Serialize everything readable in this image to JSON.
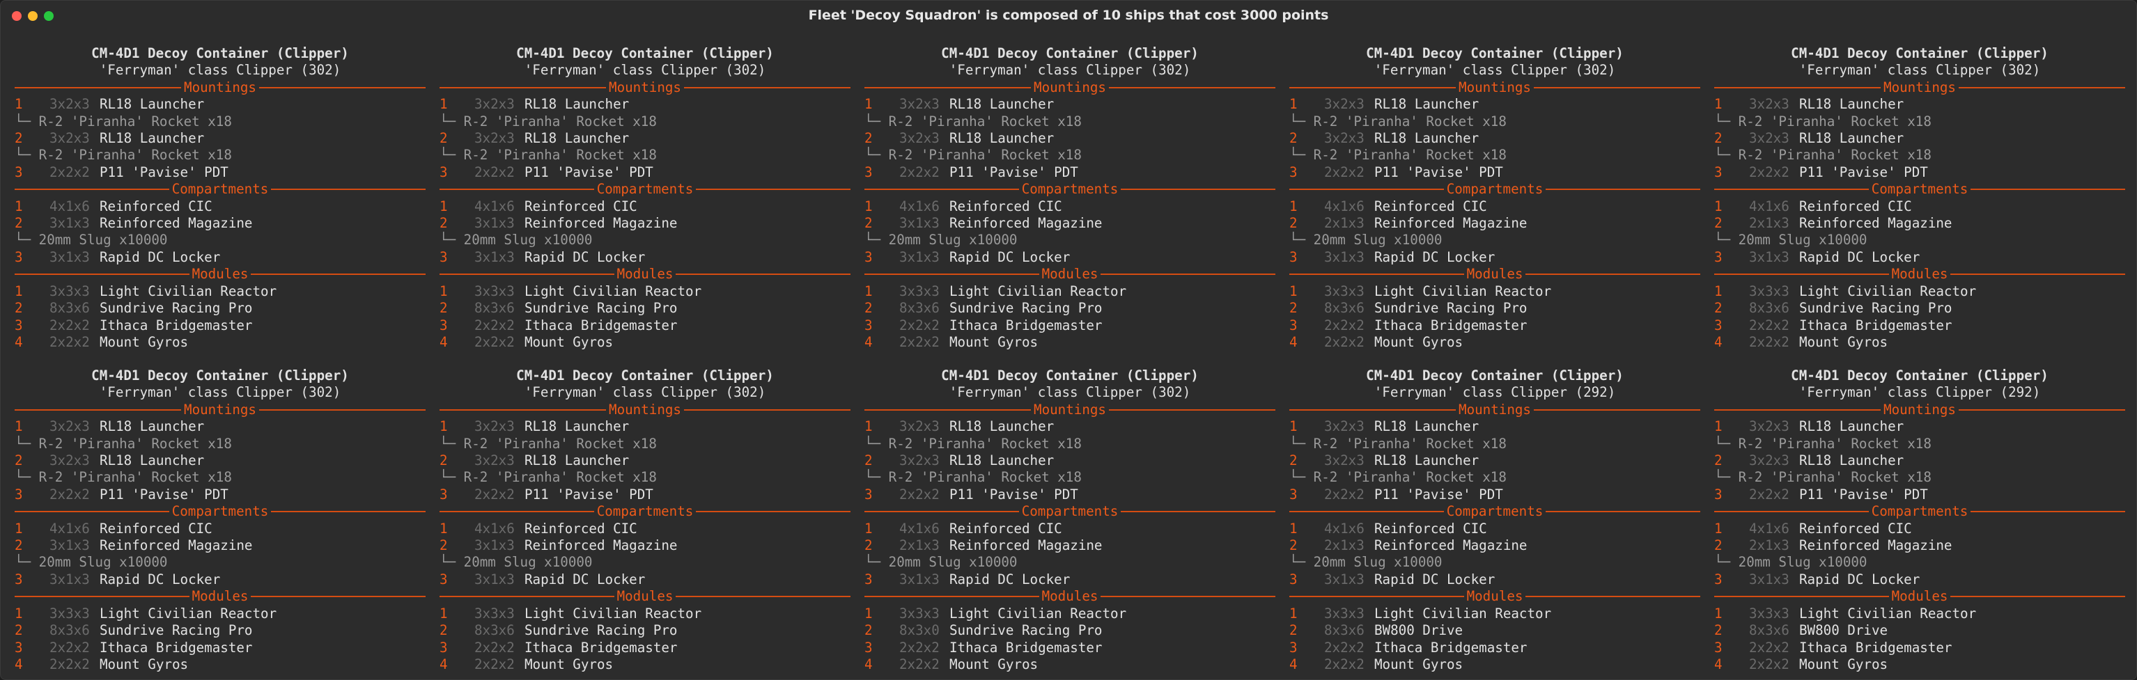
{
  "window": {
    "title": "Fleet 'Decoy Squadron' is composed of 10 ships that cost 3000 points",
    "buttons": {
      "close_color": "#ff5f57",
      "minimize_color": "#febc2e",
      "zoom_color": "#28c840"
    }
  },
  "colors": {
    "accent": "#ee5a1a",
    "text": "#e2e2e2",
    "muted": "#6b6b6b",
    "background": "#2c2c2c"
  },
  "ships": [
    {
      "name": "CM-4D1 Decoy Container (Clipper)",
      "class": "'Ferryman' class Clipper (302)",
      "mountings_label": "Mountings",
      "mountings": [
        {
          "num": "1",
          "size": "3x2x3",
          "name": "RL18 Launcher"
        },
        {
          "sub": "└─ R-2 'Piranha' Rocket x18"
        },
        {
          "num": "2",
          "size": "3x2x3",
          "name": "RL18 Launcher"
        },
        {
          "sub": "└─ R-2 'Piranha' Rocket x18"
        },
        {
          "num": "3",
          "size": "2x2x2",
          "name": "P11 'Pavise' PDT"
        }
      ],
      "compartments_label": "Compartments",
      "compartments": [
        {
          "num": "1",
          "size": "4x1x6",
          "name": "Reinforced CIC"
        },
        {
          "num": "2",
          "size": "3x1x3",
          "name": "Reinforced Magazine"
        },
        {
          "sub": "└─ 20mm Slug x10000"
        },
        {
          "num": "3",
          "size": "3x1x3",
          "name": "Rapid DC Locker"
        }
      ],
      "modules_label": "Modules",
      "modules": [
        {
          "num": "1",
          "size": "3x3x3",
          "name": "Light Civilian Reactor"
        },
        {
          "num": "2",
          "size": "8x3x6",
          "name": "Sundrive Racing Pro"
        },
        {
          "num": "3",
          "size": "2x2x2",
          "name": "Ithaca Bridgemaster"
        },
        {
          "num": "4",
          "size": "2x2x2",
          "name": "Mount Gyros"
        }
      ]
    },
    {
      "name": "CM-4D1 Decoy Container (Clipper)",
      "class": "'Ferryman' class Clipper (302)",
      "mountings_label": "Mountings",
      "mountings": [
        {
          "num": "1",
          "size": "3x2x3",
          "name": "RL18 Launcher"
        },
        {
          "sub": "└─ R-2 'Piranha' Rocket x18"
        },
        {
          "num": "2",
          "size": "3x2x3",
          "name": "RL18 Launcher"
        },
        {
          "sub": "└─ R-2 'Piranha' Rocket x18"
        },
        {
          "num": "3",
          "size": "2x2x2",
          "name": "P11 'Pavise' PDT"
        }
      ],
      "compartments_label": "Compartments",
      "compartments": [
        {
          "num": "1",
          "size": "4x1x6",
          "name": "Reinforced CIC"
        },
        {
          "num": "2",
          "size": "3x1x3",
          "name": "Reinforced Magazine"
        },
        {
          "sub": "└─ 20mm Slug x10000"
        },
        {
          "num": "3",
          "size": "3x1x3",
          "name": "Rapid DC Locker"
        }
      ],
      "modules_label": "Modules",
      "modules": [
        {
          "num": "1",
          "size": "3x3x3",
          "name": "Light Civilian Reactor"
        },
        {
          "num": "2",
          "size": "8x3x6",
          "name": "Sundrive Racing Pro"
        },
        {
          "num": "3",
          "size": "2x2x2",
          "name": "Ithaca Bridgemaster"
        },
        {
          "num": "4",
          "size": "2x2x2",
          "name": "Mount Gyros"
        }
      ]
    },
    {
      "name": "CM-4D1 Decoy Container (Clipper)",
      "class": "'Ferryman' class Clipper (302)",
      "mountings_label": "Mountings",
      "mountings": [
        {
          "num": "1",
          "size": "3x2x3",
          "name": "RL18 Launcher"
        },
        {
          "sub": "└─ R-2 'Piranha' Rocket x18"
        },
        {
          "num": "2",
          "size": "3x2x3",
          "name": "RL18 Launcher"
        },
        {
          "sub": "└─ R-2 'Piranha' Rocket x18"
        },
        {
          "num": "3",
          "size": "2x2x2",
          "name": "P11 'Pavise' PDT"
        }
      ],
      "compartments_label": "Compartments",
      "compartments": [
        {
          "num": "1",
          "size": "4x1x6",
          "name": "Reinforced CIC"
        },
        {
          "num": "2",
          "size": "3x1x3",
          "name": "Reinforced Magazine"
        },
        {
          "sub": "└─ 20mm Slug x10000"
        },
        {
          "num": "3",
          "size": "3x1x3",
          "name": "Rapid DC Locker"
        }
      ],
      "modules_label": "Modules",
      "modules": [
        {
          "num": "1",
          "size": "3x3x3",
          "name": "Light Civilian Reactor"
        },
        {
          "num": "2",
          "size": "8x3x6",
          "name": "Sundrive Racing Pro"
        },
        {
          "num": "3",
          "size": "2x2x2",
          "name": "Ithaca Bridgemaster"
        },
        {
          "num": "4",
          "size": "2x2x2",
          "name": "Mount Gyros"
        }
      ]
    },
    {
      "name": "CM-4D1 Decoy Container (Clipper)",
      "class": "'Ferryman' class Clipper (302)",
      "mountings_label": "Mountings",
      "mountings": [
        {
          "num": "1",
          "size": "3x2x3",
          "name": "RL18 Launcher"
        },
        {
          "sub": "└─ R-2 'Piranha' Rocket x18"
        },
        {
          "num": "2",
          "size": "3x2x3",
          "name": "RL18 Launcher"
        },
        {
          "sub": "└─ R-2 'Piranha' Rocket x18"
        },
        {
          "num": "3",
          "size": "2x2x2",
          "name": "P11 'Pavise' PDT"
        }
      ],
      "compartments_label": "Compartments",
      "compartments": [
        {
          "num": "1",
          "size": "4x1x6",
          "name": "Reinforced CIC"
        },
        {
          "num": "2",
          "size": "2x1x3",
          "name": "Reinforced Magazine"
        },
        {
          "sub": "└─ 20mm Slug x10000"
        },
        {
          "num": "3",
          "size": "3x1x3",
          "name": "Rapid DC Locker"
        }
      ],
      "modules_label": "Modules",
      "modules": [
        {
          "num": "1",
          "size": "3x3x3",
          "name": "Light Civilian Reactor"
        },
        {
          "num": "2",
          "size": "8x3x6",
          "name": "Sundrive Racing Pro"
        },
        {
          "num": "3",
          "size": "2x2x2",
          "name": "Ithaca Bridgemaster"
        },
        {
          "num": "4",
          "size": "2x2x2",
          "name": "Mount Gyros"
        }
      ]
    },
    {
      "name": "CM-4D1 Decoy Container (Clipper)",
      "class": "'Ferryman' class Clipper (302)",
      "mountings_label": "Mountings",
      "mountings": [
        {
          "num": "1",
          "size": "3x2x3",
          "name": "RL18 Launcher"
        },
        {
          "sub": "└─ R-2 'Piranha' Rocket x18"
        },
        {
          "num": "2",
          "size": "3x2x3",
          "name": "RL18 Launcher"
        },
        {
          "sub": "└─ R-2 'Piranha' Rocket x18"
        },
        {
          "num": "3",
          "size": "2x2x2",
          "name": "P11 'Pavise' PDT"
        }
      ],
      "compartments_label": "Compartments",
      "compartments": [
        {
          "num": "1",
          "size": "4x1x6",
          "name": "Reinforced CIC"
        },
        {
          "num": "2",
          "size": "2x1x3",
          "name": "Reinforced Magazine"
        },
        {
          "sub": "└─ 20mm Slug x10000"
        },
        {
          "num": "3",
          "size": "3x1x3",
          "name": "Rapid DC Locker"
        }
      ],
      "modules_label": "Modules",
      "modules": [
        {
          "num": "1",
          "size": "3x3x3",
          "name": "Light Civilian Reactor"
        },
        {
          "num": "2",
          "size": "8x3x6",
          "name": "Sundrive Racing Pro"
        },
        {
          "num": "3",
          "size": "2x2x2",
          "name": "Ithaca Bridgemaster"
        },
        {
          "num": "4",
          "size": "2x2x2",
          "name": "Mount Gyros"
        }
      ]
    },
    {
      "name": "CM-4D1 Decoy Container (Clipper)",
      "class": "'Ferryman' class Clipper (302)",
      "mountings_label": "Mountings",
      "mountings": [
        {
          "num": "1",
          "size": "3x2x3",
          "name": "RL18 Launcher"
        },
        {
          "sub": "└─ R-2 'Piranha' Rocket x18"
        },
        {
          "num": "2",
          "size": "3x2x3",
          "name": "RL18 Launcher"
        },
        {
          "sub": "└─ R-2 'Piranha' Rocket x18"
        },
        {
          "num": "3",
          "size": "2x2x2",
          "name": "P11 'Pavise' PDT"
        }
      ],
      "compartments_label": "Compartments",
      "compartments": [
        {
          "num": "1",
          "size": "4x1x6",
          "name": "Reinforced CIC"
        },
        {
          "num": "2",
          "size": "3x1x3",
          "name": "Reinforced Magazine"
        },
        {
          "sub": "└─ 20mm Slug x10000"
        },
        {
          "num": "3",
          "size": "3x1x3",
          "name": "Rapid DC Locker"
        }
      ],
      "modules_label": "Modules",
      "modules": [
        {
          "num": "1",
          "size": "3x3x3",
          "name": "Light Civilian Reactor"
        },
        {
          "num": "2",
          "size": "8x3x6",
          "name": "Sundrive Racing Pro"
        },
        {
          "num": "3",
          "size": "2x2x2",
          "name": "Ithaca Bridgemaster"
        },
        {
          "num": "4",
          "size": "2x2x2",
          "name": "Mount Gyros"
        }
      ]
    },
    {
      "name": "CM-4D1 Decoy Container (Clipper)",
      "class": "'Ferryman' class Clipper (302)",
      "mountings_label": "Mountings",
      "mountings": [
        {
          "num": "1",
          "size": "3x2x3",
          "name": "RL18 Launcher"
        },
        {
          "sub": "└─ R-2 'Piranha' Rocket x18"
        },
        {
          "num": "2",
          "size": "3x2x3",
          "name": "RL18 Launcher"
        },
        {
          "sub": "└─ R-2 'Piranha' Rocket x18"
        },
        {
          "num": "3",
          "size": "2x2x2",
          "name": "P11 'Pavise' PDT"
        }
      ],
      "compartments_label": "Compartments",
      "compartments": [
        {
          "num": "1",
          "size": "4x1x6",
          "name": "Reinforced CIC"
        },
        {
          "num": "2",
          "size": "3x1x3",
          "name": "Reinforced Magazine"
        },
        {
          "sub": "└─ 20mm Slug x10000"
        },
        {
          "num": "3",
          "size": "3x1x3",
          "name": "Rapid DC Locker"
        }
      ],
      "modules_label": "Modules",
      "modules": [
        {
          "num": "1",
          "size": "3x3x3",
          "name": "Light Civilian Reactor"
        },
        {
          "num": "2",
          "size": "8x3x6",
          "name": "Sundrive Racing Pro"
        },
        {
          "num": "3",
          "size": "2x2x2",
          "name": "Ithaca Bridgemaster"
        },
        {
          "num": "4",
          "size": "2x2x2",
          "name": "Mount Gyros"
        }
      ]
    },
    {
      "name": "CM-4D1 Decoy Container (Clipper)",
      "class": "'Ferryman' class Clipper (302)",
      "mountings_label": "Mountings",
      "mountings": [
        {
          "num": "1",
          "size": "3x2x3",
          "name": "RL18 Launcher"
        },
        {
          "sub": "└─ R-2 'Piranha' Rocket x18"
        },
        {
          "num": "2",
          "size": "3x2x3",
          "name": "RL18 Launcher"
        },
        {
          "sub": "└─ R-2 'Piranha' Rocket x18"
        },
        {
          "num": "3",
          "size": "2x2x2",
          "name": "P11 'Pavise' PDT"
        }
      ],
      "compartments_label": "Compartments",
      "compartments": [
        {
          "num": "1",
          "size": "4x1x6",
          "name": "Reinforced CIC"
        },
        {
          "num": "2",
          "size": "2x1x3",
          "name": "Reinforced Magazine"
        },
        {
          "sub": "└─ 20mm Slug x10000"
        },
        {
          "num": "3",
          "size": "3x1x3",
          "name": "Rapid DC Locker"
        }
      ],
      "modules_label": "Modules",
      "modules": [
        {
          "num": "1",
          "size": "3x3x3",
          "name": "Light Civilian Reactor"
        },
        {
          "num": "2",
          "size": "8x3x0",
          "name": "Sundrive Racing Pro"
        },
        {
          "num": "3",
          "size": "2x2x2",
          "name": "Ithaca Bridgemaster"
        },
        {
          "num": "4",
          "size": "2x2x2",
          "name": "Mount Gyros"
        }
      ]
    },
    {
      "name": "CM-4D1 Decoy Container (Clipper)",
      "class": "'Ferryman' class Clipper (292)",
      "mountings_label": "Mountings",
      "mountings": [
        {
          "num": "1",
          "size": "3x2x3",
          "name": "RL18 Launcher"
        },
        {
          "sub": "└─ R-2 'Piranha' Rocket x18"
        },
        {
          "num": "2",
          "size": "3x2x3",
          "name": "RL18 Launcher"
        },
        {
          "sub": "└─ R-2 'Piranha' Rocket x18"
        },
        {
          "num": "3",
          "size": "2x2x2",
          "name": "P11 'Pavise' PDT"
        }
      ],
      "compartments_label": "Compartments",
      "compartments": [
        {
          "num": "1",
          "size": "4x1x6",
          "name": "Reinforced CIC"
        },
        {
          "num": "2",
          "size": "2x1x3",
          "name": "Reinforced Magazine"
        },
        {
          "sub": "└─ 20mm Slug x10000"
        },
        {
          "num": "3",
          "size": "3x1x3",
          "name": "Rapid DC Locker"
        }
      ],
      "modules_label": "Modules",
      "modules": [
        {
          "num": "1",
          "size": "3x3x3",
          "name": "Light Civilian Reactor"
        },
        {
          "num": "2",
          "size": "8x3x6",
          "name": "BW800 Drive"
        },
        {
          "num": "3",
          "size": "2x2x2",
          "name": "Ithaca Bridgemaster"
        },
        {
          "num": "4",
          "size": "2x2x2",
          "name": "Mount Gyros"
        }
      ]
    },
    {
      "name": "CM-4D1 Decoy Container (Clipper)",
      "class": "'Ferryman' class Clipper (292)",
      "mountings_label": "Mountings",
      "mountings": [
        {
          "num": "1",
          "size": "3x2x3",
          "name": "RL18 Launcher"
        },
        {
          "sub": "└─ R-2 'Piranha' Rocket x18"
        },
        {
          "num": "2",
          "size": "3x2x3",
          "name": "RL18 Launcher"
        },
        {
          "sub": "└─ R-2 'Piranha' Rocket x18"
        },
        {
          "num": "3",
          "size": "2x2x2",
          "name": "P11 'Pavise' PDT"
        }
      ],
      "compartments_label": "Compartments",
      "compartments": [
        {
          "num": "1",
          "size": "4x1x6",
          "name": "Reinforced CIC"
        },
        {
          "num": "2",
          "size": "2x1x3",
          "name": "Reinforced Magazine"
        },
        {
          "sub": "└─ 20mm Slug x10000"
        },
        {
          "num": "3",
          "size": "3x1x3",
          "name": "Rapid DC Locker"
        }
      ],
      "modules_label": "Modules",
      "modules": [
        {
          "num": "1",
          "size": "3x3x3",
          "name": "Light Civilian Reactor"
        },
        {
          "num": "2",
          "size": "8x3x6",
          "name": "BW800 Drive"
        },
        {
          "num": "3",
          "size": "2x2x2",
          "name": "Ithaca Bridgemaster"
        },
        {
          "num": "4",
          "size": "2x2x2",
          "name": "Mount Gyros"
        }
      ]
    }
  ]
}
